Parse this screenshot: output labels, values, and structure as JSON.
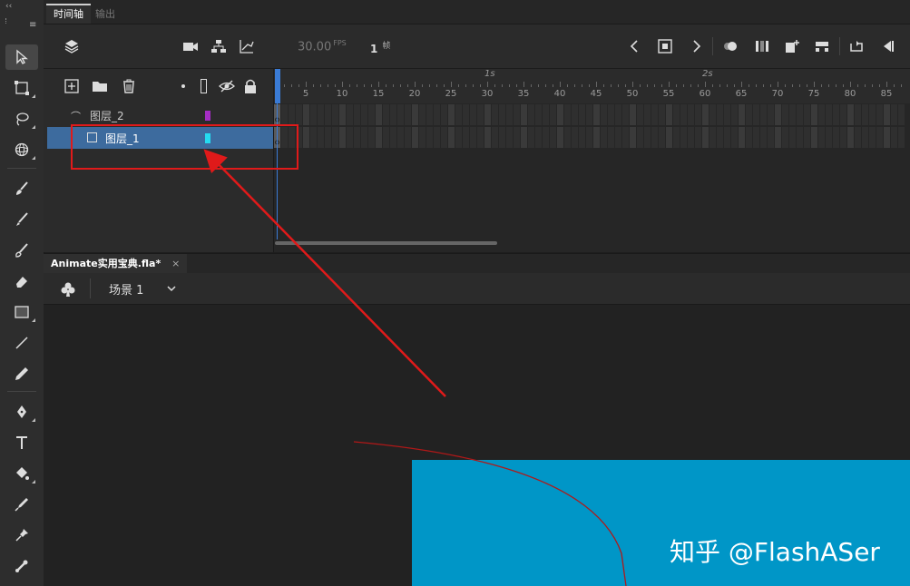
{
  "top_tabs": [
    {
      "label": "时间轴",
      "active": true
    },
    {
      "label": "输出",
      "active": false
    }
  ],
  "timeline": {
    "fps": "30.00",
    "fps_unit": "FPS",
    "current_frame": "1",
    "frame_unit": "帧",
    "ruler_seconds": [
      "1s",
      "2s"
    ],
    "ruler_numbers": [
      "5",
      "10",
      "15",
      "20",
      "25",
      "30",
      "35",
      "40",
      "45",
      "50",
      "55",
      "60",
      "65",
      "70",
      "75",
      "80",
      "85"
    ]
  },
  "layers": [
    {
      "name": "图层_2",
      "color": "#a42dc4",
      "selected": false
    },
    {
      "name": "图层_1",
      "color": "#25dbf0",
      "selected": true
    }
  ],
  "document": {
    "tab_title": "Animate实用宝典.fla*",
    "close_glyph": "×",
    "scene_label": "场景 1"
  },
  "watermark": "知乎 @FlashASer",
  "colors": {
    "accent": "#3d6b9e",
    "stage": "#0096c7",
    "annotation": "#e01a1a"
  }
}
